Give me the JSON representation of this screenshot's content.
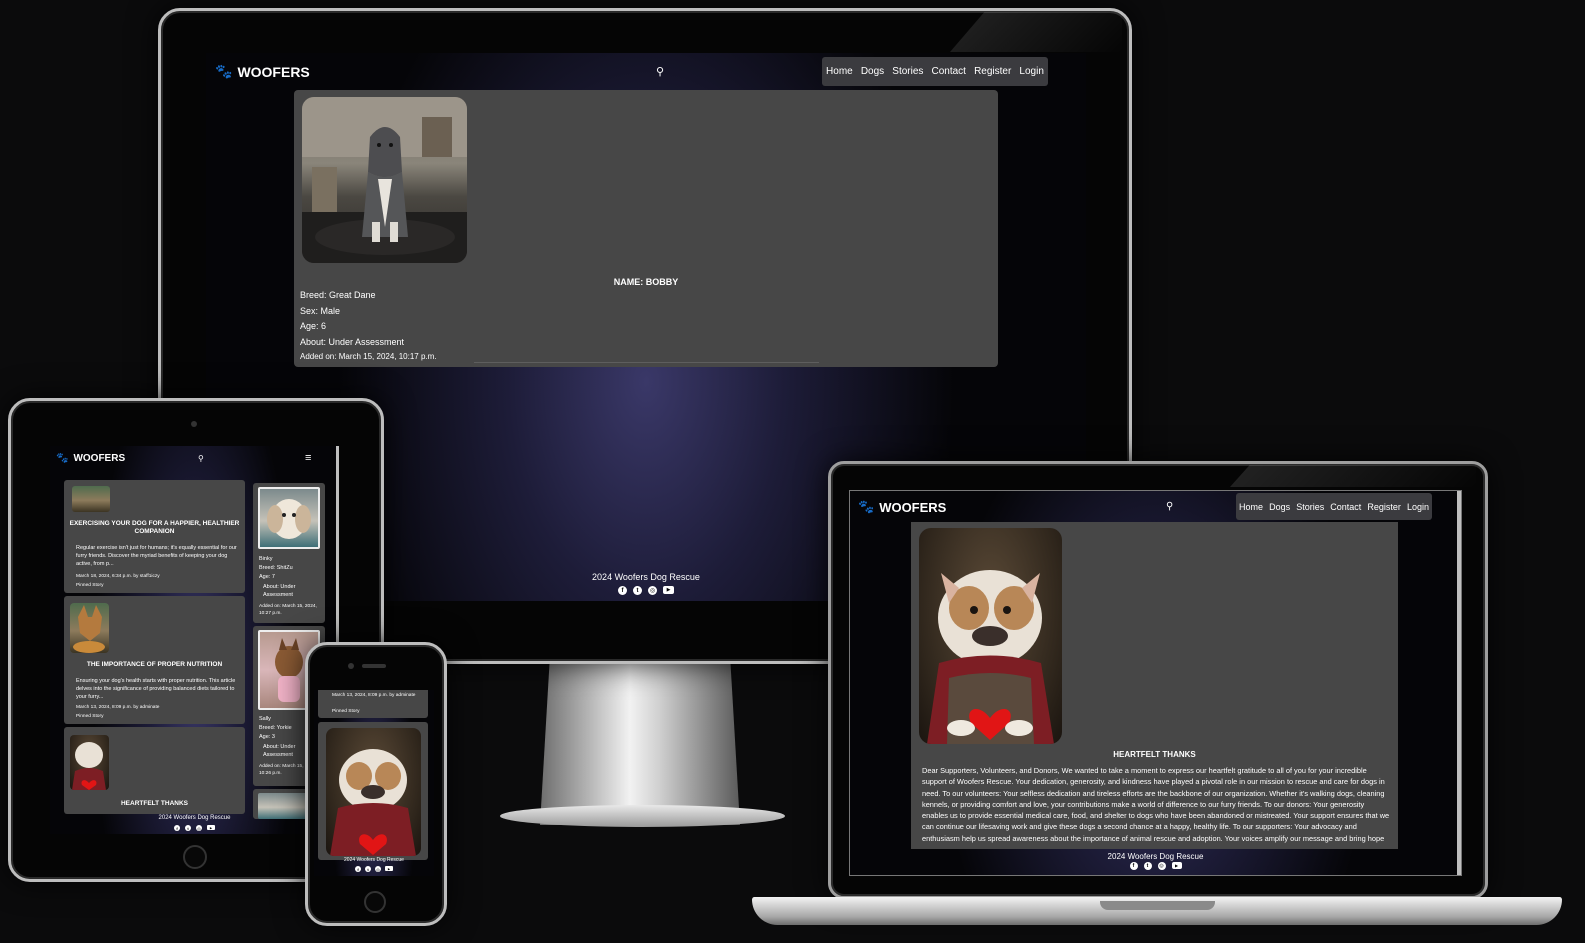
{
  "site": {
    "brand": "WOOFERS",
    "nav": [
      "Home",
      "Dogs",
      "Stories",
      "Contact",
      "Register",
      "Login"
    ],
    "footer": "2024 Woofers Dog Rescue",
    "social_icons": [
      "facebook-icon",
      "twitter-icon",
      "instagram-icon",
      "youtube-icon"
    ]
  },
  "desktop": {
    "dog": {
      "name": "NAME: BOBBY",
      "breed": "Breed: Great Dane",
      "sex": "Sex: Male",
      "age": "Age: 6",
      "about": "About: Under Assessment",
      "added": "Added on: March 15, 2024, 10:17 p.m."
    }
  },
  "laptop": {
    "story_title": "HEARTFELT THANKS",
    "story_body": "Dear Supporters, Volunteers, and Donors, We wanted to take a moment to express our heartfelt gratitude to all of you for your incredible support of Woofers Rescue. Your dedication, generosity, and kindness have played a pivotal role in our mission to rescue and care for dogs in need. To our volunteers: Your selfless dedication and tireless efforts are the backbone of our organization. Whether it's walking dogs, cleaning kennels, or providing comfort and love, your contributions make a world of difference to our furry friends. To our donors: Your generosity enables us to provide essential medical care, food, and shelter to dogs who have been abandoned or mistreated. Your support ensures that we can continue our lifesaving work and give these dogs a second chance at a happy, healthy life. To our supporters: Your advocacy and enthusiasm help us spread awareness about the importance of animal rescue and adoption. Your voices amplify our message and bring hope to countless dogs in need. Thank you for being an essential part of the [Dog Rescue Name] family. Your support"
  },
  "tablet": {
    "stories": [
      {
        "title": "EXERCISING YOUR DOG FOR A HAPPIER, HEALTHIER COMPANION",
        "excerpt": "Regular exercise isn't just for humans; it's equally essential for our furry friends. Discover the myriad benefits of keeping your dog active, from p...",
        "meta": "March 18, 2024, 6:34 p.m. by staff1iczy",
        "pinned": "Pinned Story"
      },
      {
        "title": "THE IMPORTANCE OF PROPER NUTRITION",
        "excerpt": "Ensuring your dog's health starts with proper nutrition. This article delves into the significance of providing balanced diets tailored to your furry...",
        "meta": "March 13, 2024, 8:09 p.m. by adminate",
        "pinned": "Pinned Story"
      },
      {
        "title": "HEARTFELT THANKS"
      }
    ],
    "dogs": [
      {
        "name": "Binky",
        "breed": "Breed: ShitZu",
        "age": "Age: 7",
        "about": "About: Under Assessment",
        "added": "Added on: March 15, 2024, 10:27 p.m."
      },
      {
        "name": "Sally",
        "breed": "Breed: Yorkie",
        "age": "Age: 3",
        "about": "About: Under Assessment",
        "added": "Added on: March 15, 2024, 10:26 p.m."
      }
    ]
  },
  "phone": {
    "meta": "March 13, 2024, 8:09 p.m. by adminate",
    "pinned": "Pinned Story"
  }
}
